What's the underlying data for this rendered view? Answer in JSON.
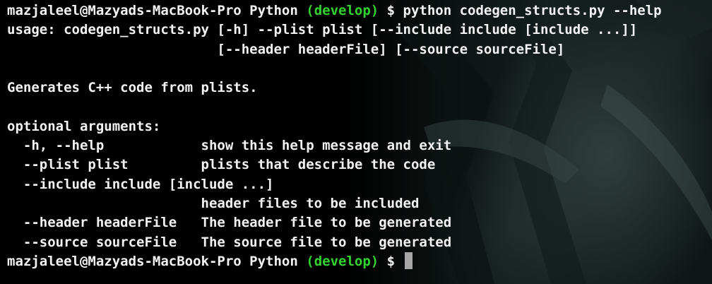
{
  "terminal": {
    "colors": {
      "background": "#000000",
      "foreground": "#f2f2f2",
      "branch": "#31d32f",
      "cursor": "#a6a6a6"
    },
    "prompt": {
      "user_host": "mazjaleel@Mazyads-MacBook-Pro Python ",
      "branch": "(develop)",
      "symbol": " $ "
    },
    "command": "python codegen_structs.py --help",
    "usage_line_1": "usage: codegen_structs.py [-h] --plist plist [--include include [include ...]]",
    "usage_line_2": "                          [--header headerFile] [--source sourceFile]",
    "description": "Generates C++ code from plists.",
    "options_heading": "optional arguments:",
    "options": [
      {
        "text": "  -h, --help            show this help message and exit"
      },
      {
        "text": "  --plist plist         plists that describe the code"
      },
      {
        "text": "  --include include [include ...]"
      },
      {
        "text": "                        header files to be included"
      },
      {
        "text": "  --header headerFile   The header file to be generated"
      },
      {
        "text": "  --source sourceFile   The source file to be generated"
      }
    ]
  }
}
